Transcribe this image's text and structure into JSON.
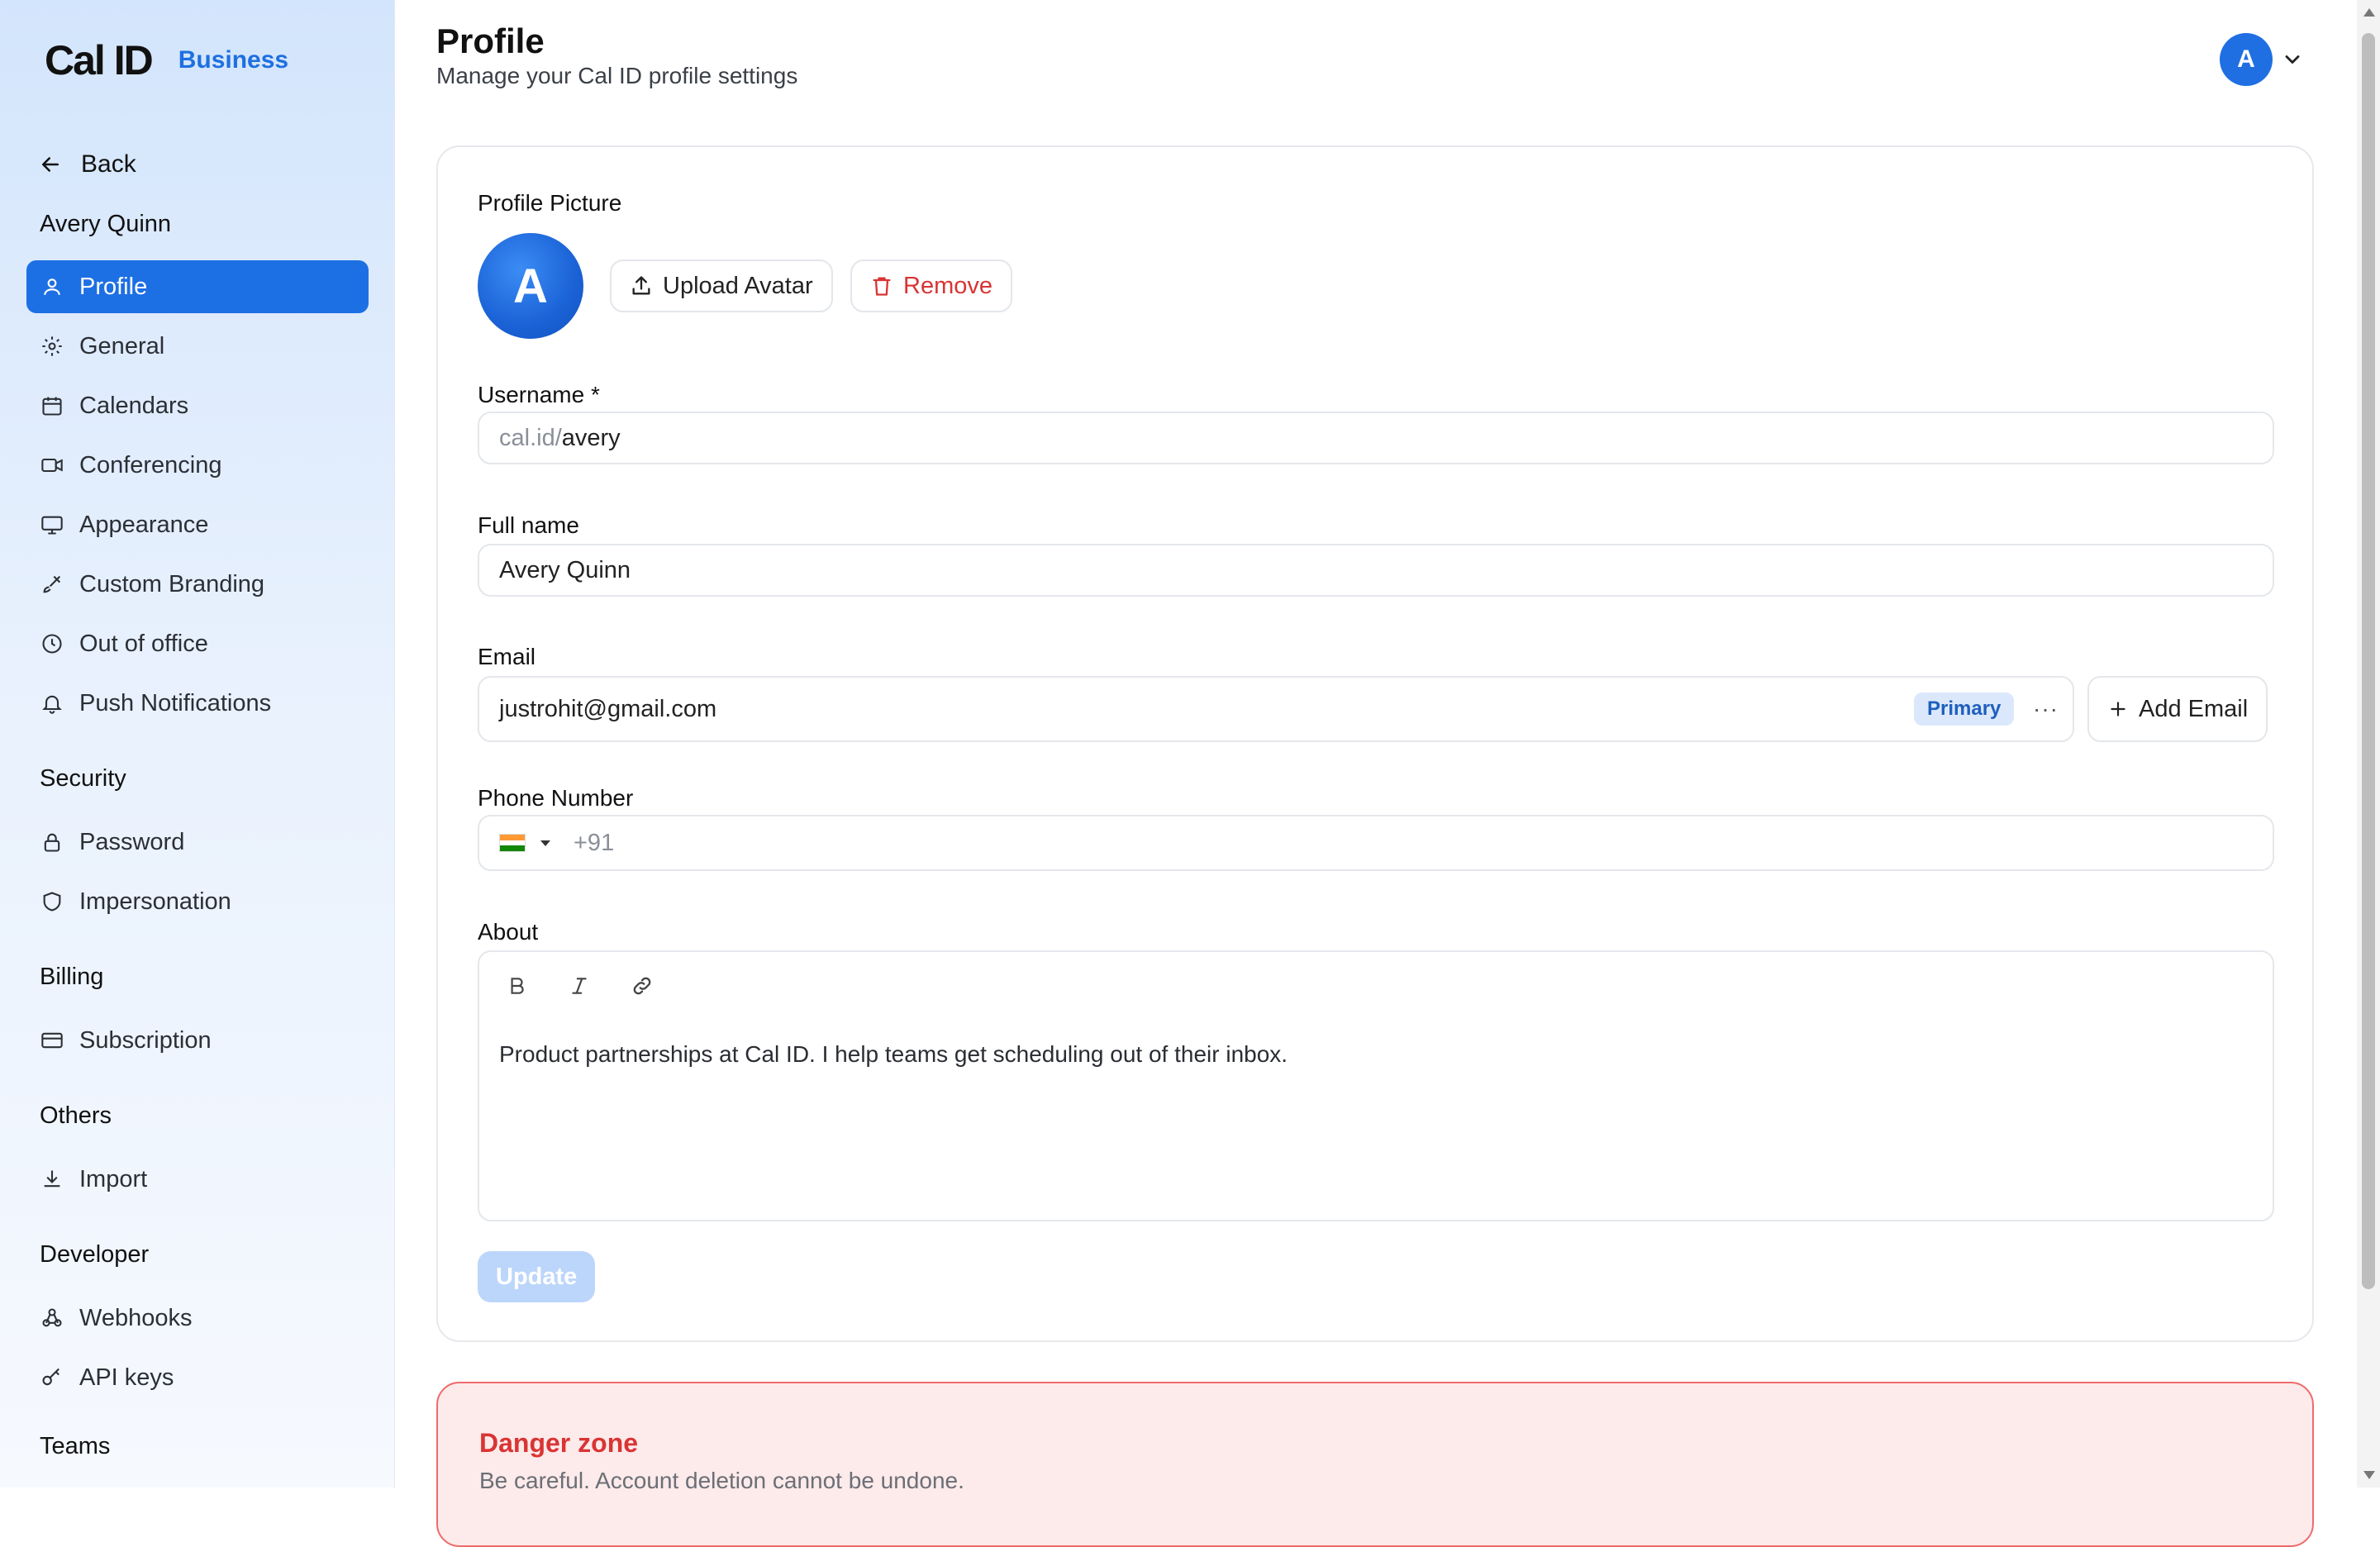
{
  "app": {
    "logo": "Cal ID",
    "plan_badge": "Business"
  },
  "sidebar": {
    "back_label": "Back",
    "user_name": "Avery Quinn",
    "items": [
      {
        "label": "Profile",
        "icon": "user-icon",
        "active": true
      },
      {
        "label": "General",
        "icon": "gear-icon"
      },
      {
        "label": "Calendars",
        "icon": "calendar-icon"
      },
      {
        "label": "Conferencing",
        "icon": "video-icon"
      },
      {
        "label": "Appearance",
        "icon": "monitor-icon"
      },
      {
        "label": "Custom Branding",
        "icon": "brush-icon"
      },
      {
        "label": "Out of office",
        "icon": "clock-icon"
      },
      {
        "label": "Push Notifications",
        "icon": "bell-icon"
      }
    ],
    "sections": {
      "security": {
        "title": "Security",
        "items": [
          {
            "label": "Password",
            "icon": "lock-icon"
          },
          {
            "label": "Impersonation",
            "icon": "shield-icon"
          }
        ]
      },
      "billing": {
        "title": "Billing",
        "items": [
          {
            "label": "Subscription",
            "icon": "credit-card-icon"
          }
        ]
      },
      "others": {
        "title": "Others",
        "items": [
          {
            "label": "Import",
            "icon": "download-icon"
          }
        ]
      },
      "developer": {
        "title": "Developer",
        "items": [
          {
            "label": "Webhooks",
            "icon": "webhook-icon"
          },
          {
            "label": "API keys",
            "icon": "key-icon"
          }
        ]
      },
      "teams": {
        "title": "Teams"
      }
    }
  },
  "header": {
    "title": "Profile",
    "subtitle": "Manage your Cal ID profile settings",
    "avatar_initial": "A"
  },
  "profile": {
    "picture_label": "Profile Picture",
    "avatar_initial": "A",
    "upload_label": "Upload Avatar",
    "remove_label": "Remove",
    "username_label": "Username *",
    "username_prefix": "cal.id/",
    "username_value": "avery",
    "fullname_label": "Full name",
    "fullname_value": "Avery Quinn",
    "email_label": "Email",
    "email_value": "justrohit@gmail.com",
    "email_badge": "Primary",
    "email_more": "···",
    "add_email_label": "Add Email",
    "phone_label": "Phone Number",
    "phone_code": "+91",
    "about_label": "About",
    "about_text": "Product partnerships at Cal ID. I help teams get scheduling out of their inbox.",
    "update_label": "Update"
  },
  "danger": {
    "title": "Danger zone",
    "subtitle": "Be careful. Account deletion cannot be undone."
  },
  "colors": {
    "accent": "#1d6fe4",
    "danger": "#d93434",
    "danger_bg": "#fdeaea"
  }
}
